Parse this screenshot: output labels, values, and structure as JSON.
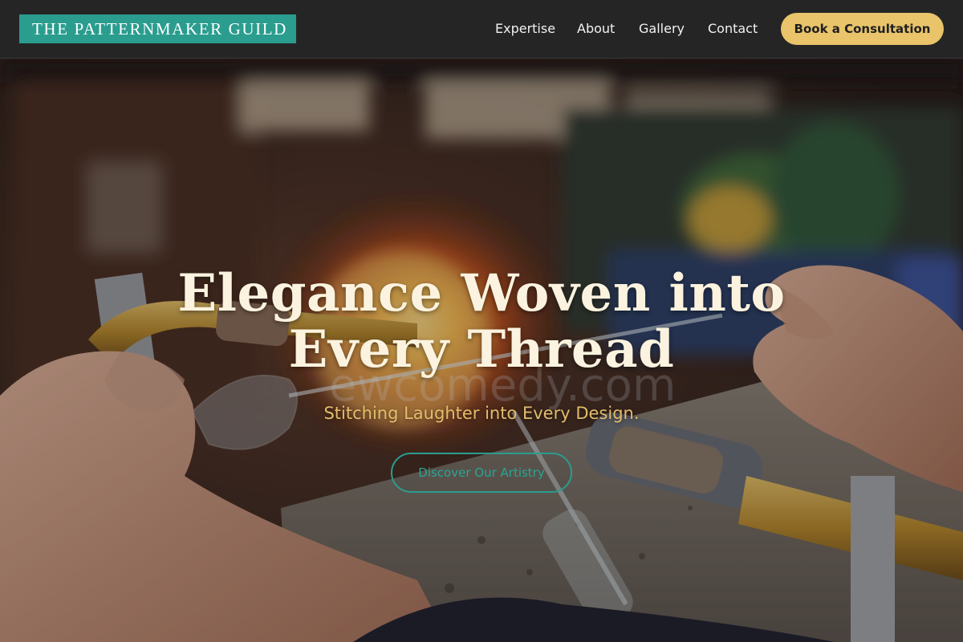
{
  "header": {
    "logo_text": "THE PATTERNMAKER GUILD",
    "nav": [
      {
        "label": "Expertise"
      },
      {
        "label": "About"
      },
      {
        "label": "Gallery"
      },
      {
        "label": "Contact"
      }
    ],
    "cta_label": "Book a Consultation"
  },
  "hero": {
    "title_line1": "Elegance Woven into",
    "title_line2": "Every Thread",
    "subtitle": "Stitching Laughter into Every Design.",
    "button_label": "Discover Our Artistry",
    "watermark_text": "ewcomedy.com",
    "image_subject": "glassblowing-torch-photo"
  },
  "colors": {
    "header_bg": "#252525",
    "logo_bg": "#2a9d8f",
    "accent_gold": "#e9c46a",
    "accent_teal": "#2a9d8f",
    "title_cream": "#fbf3df",
    "subtitle_gold": "#e2bc6c"
  }
}
